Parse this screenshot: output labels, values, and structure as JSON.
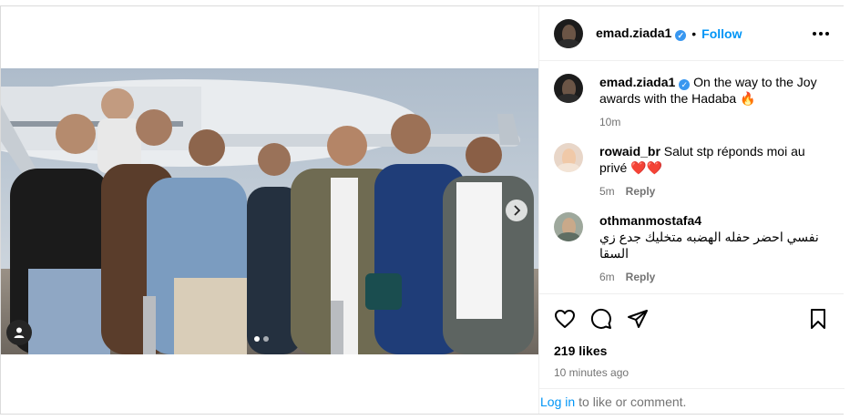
{
  "post": {
    "username": "emad.ziada1",
    "follow_label": "Follow",
    "bullet": "•",
    "verified_mark": "✓",
    "caption": "On the way to the Joy awards with the Hadaba",
    "caption_emoji": "🔥",
    "caption_time": "10m",
    "likes": "219 likes",
    "posted_ago": "10 minutes ago"
  },
  "comments": [
    {
      "username": "rowaid_br",
      "text": "Salut stp réponds moi au privé",
      "emoji": "❤️❤️",
      "time": "5m",
      "reply_label": "Reply"
    },
    {
      "username": "othmanmostafa4",
      "text": "نفسي احضر حفله الهضبه متخليك جدع زي السقا",
      "time": "6m",
      "reply_label": "Reply"
    }
  ],
  "footer": {
    "login_link": "Log in",
    "login_rest": "to like or comment."
  },
  "icons": {
    "more": "more-options-icon",
    "like": "heart-icon",
    "comment": "comment-icon",
    "share": "share-icon",
    "save": "bookmark-icon",
    "next": "chevron-right-icon",
    "tags": "user-tag-icon"
  },
  "colors": {
    "accent": "#0095f6",
    "verified": "#3897f0",
    "muted": "#737373",
    "border": "#dbdbdb"
  }
}
